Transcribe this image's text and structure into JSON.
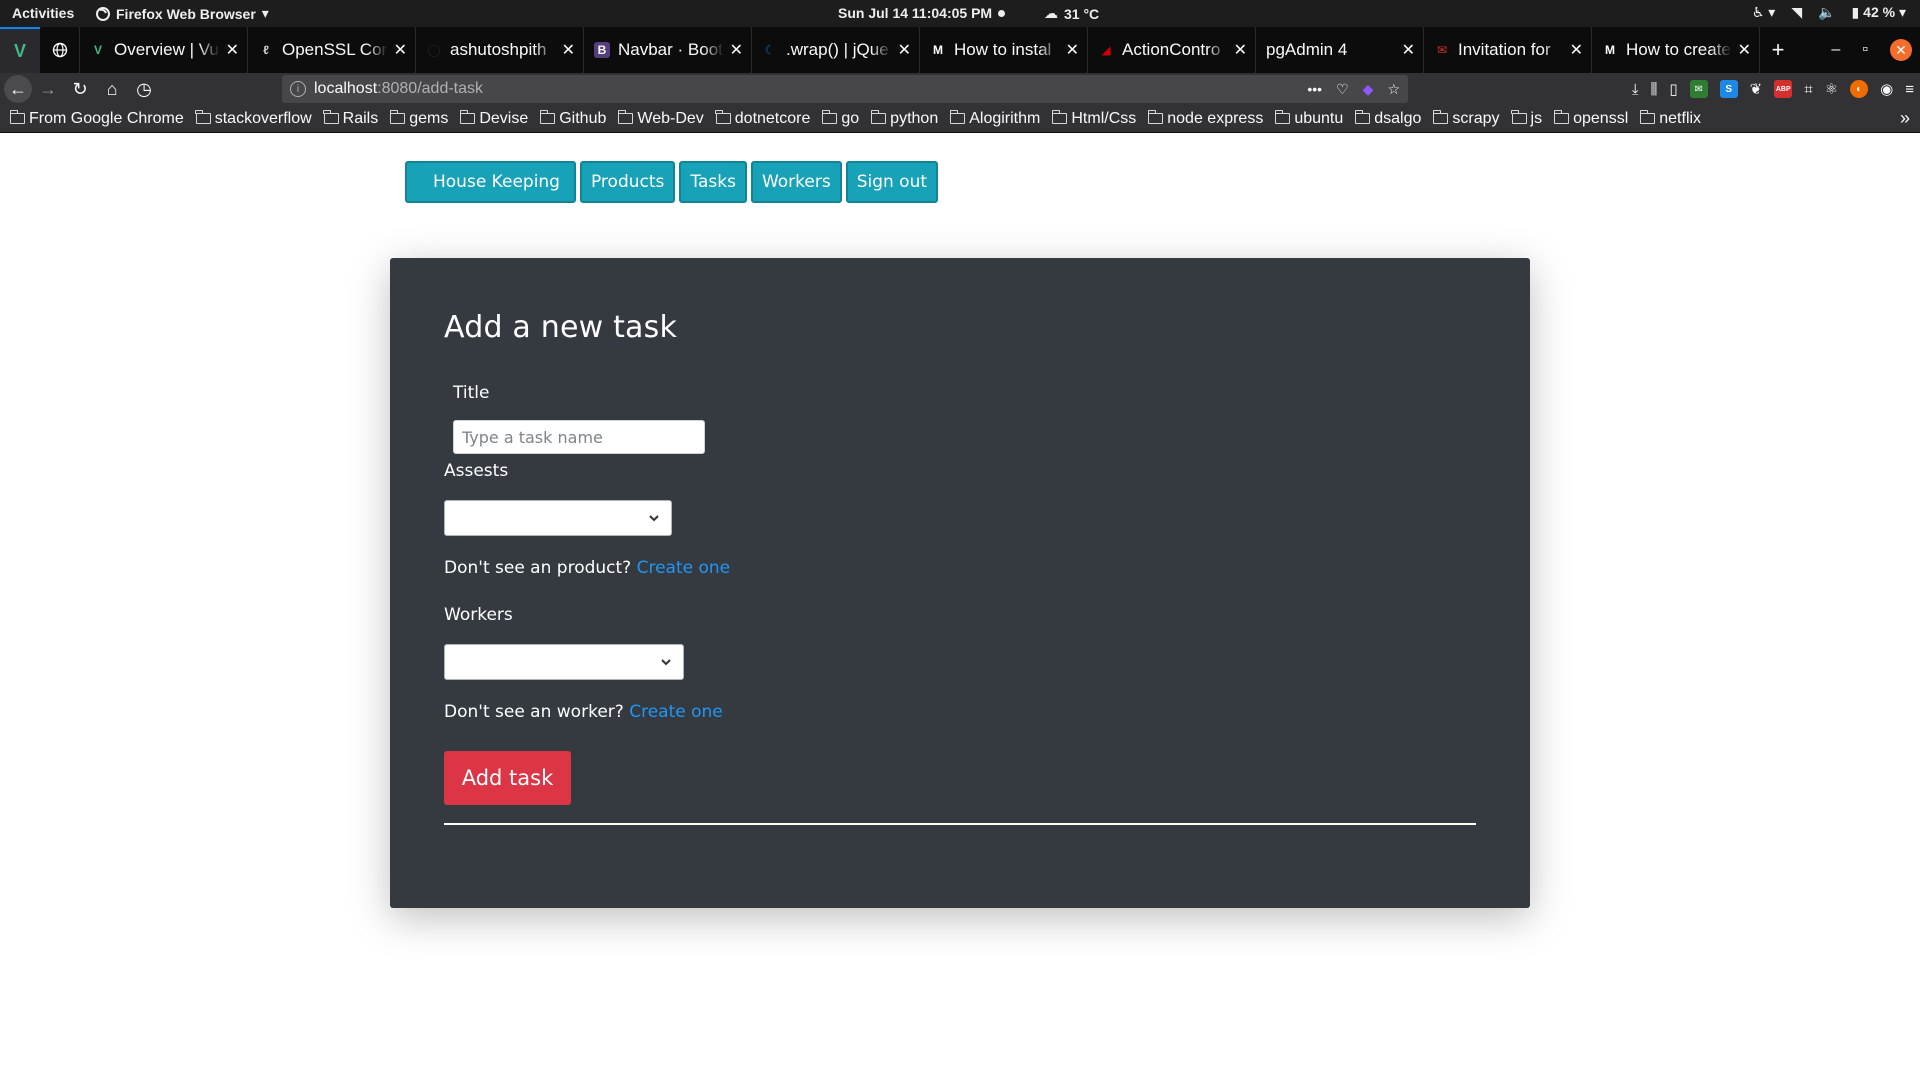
{
  "system_bar": {
    "activities": "Activities",
    "app_name": "Firefox Web Browser",
    "clock": "Sun Jul 14  11:04:05 PM",
    "weather": "31 °C",
    "battery": "42 %"
  },
  "tabs": [
    {
      "title": "Overview | Vu",
      "favicon": "vue-icon",
      "color": "#42b883",
      "glyph": "V"
    },
    {
      "title": "OpenSSL Com",
      "favicon": "openssl-icon",
      "color": "#cccccc",
      "glyph": "ℓ"
    },
    {
      "title": "ashutoshpith",
      "favicon": "github-icon",
      "color": "#222222",
      "glyph": "◯"
    },
    {
      "title": "Navbar · Boot",
      "favicon": "bootstrap-icon",
      "color": "#563d7c",
      "glyph": "B"
    },
    {
      "title": ".wrap() | jQue",
      "favicon": "jquery-icon",
      "color": "#0769ad",
      "glyph": "☾"
    },
    {
      "title": "How to instal",
      "favicon": "medium-icon",
      "color": "#ffffff",
      "glyph": "M"
    },
    {
      "title": "ActionContro",
      "favicon": "rails-icon",
      "color": "#cc0000",
      "glyph": "◢"
    },
    {
      "title": "pgAdmin 4",
      "favicon": "",
      "color": "",
      "glyph": ""
    },
    {
      "title": "Invitation for",
      "favicon": "gmail-icon",
      "color": "#d93025",
      "glyph": "✉"
    },
    {
      "title": "How to create",
      "favicon": "medium-icon",
      "color": "#ffffff",
      "glyph": "M"
    }
  ],
  "url": {
    "host": "localhost",
    "path": ":8080/add-task"
  },
  "bookmarks": [
    "From Google Chrome",
    "stackoverflow",
    "Rails",
    "gems",
    "Devise",
    "Github",
    "Web-Dev",
    "dotnetcore",
    "go",
    "python",
    "Alogirithm",
    "Html/Css",
    "node express",
    "ubuntu",
    "dsalgo",
    "scrapy",
    "js",
    "openssl",
    "netflix"
  ],
  "app_nav": {
    "brand": "House Keeping",
    "products": "Products",
    "tasks": "Tasks",
    "workers": "Workers",
    "signout": "Sign out",
    "color": "#17a2b8"
  },
  "form": {
    "heading": "Add a new task",
    "title_label": "Title",
    "title_placeholder": "Type a task name",
    "title_value": "",
    "assets_label": "Assests",
    "assets_selected": "",
    "product_hint": "Don't see an product?",
    "product_link": "Create one",
    "workers_label": "Workers",
    "workers_selected": "",
    "worker_hint": "Don't see an worker?",
    "worker_link": "Create one",
    "submit": "Add task",
    "submit_color": "#dc3545",
    "card_color": "#343a40",
    "link_color": "#2196f3"
  }
}
